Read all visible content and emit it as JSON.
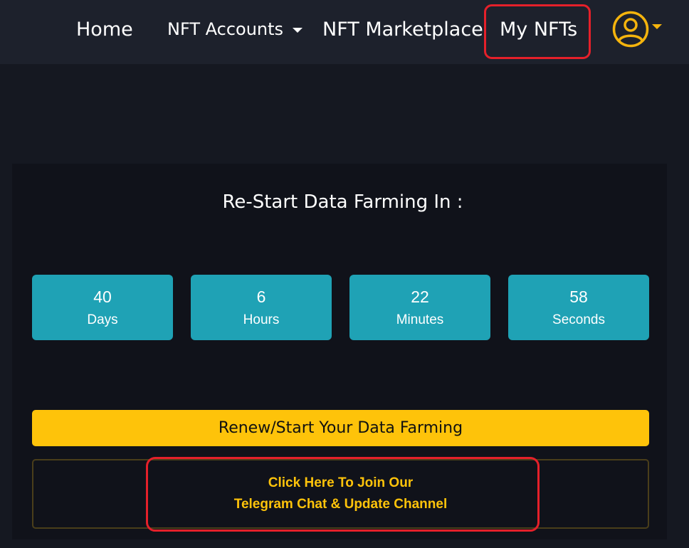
{
  "nav": {
    "home": "Home",
    "accounts": "NFT Accounts",
    "marketplace": "NFT Marketplace",
    "my_nfts": "My NFTs",
    "avatar_icon": "user-circle-icon",
    "caret_icon": "caret-down-icon"
  },
  "countdown": {
    "title": "Re-Start Data Farming In :",
    "units": [
      {
        "value": "40",
        "label": "Days"
      },
      {
        "value": "6",
        "label": "Hours"
      },
      {
        "value": "22",
        "label": "Minutes"
      },
      {
        "value": "58",
        "label": "Seconds"
      }
    ]
  },
  "renew_button": "Renew/Start Your Data Farming",
  "telegram": {
    "line1": "Click Here To Join Our",
    "line2": "Telegram Chat & Update Channel"
  },
  "colors": {
    "background": "#151821",
    "navbar": "#1d212c",
    "card": "#10121a",
    "timer_box": "#1fa2b5",
    "accent_yellow": "#fec30a",
    "highlight_red": "#e5202a"
  }
}
